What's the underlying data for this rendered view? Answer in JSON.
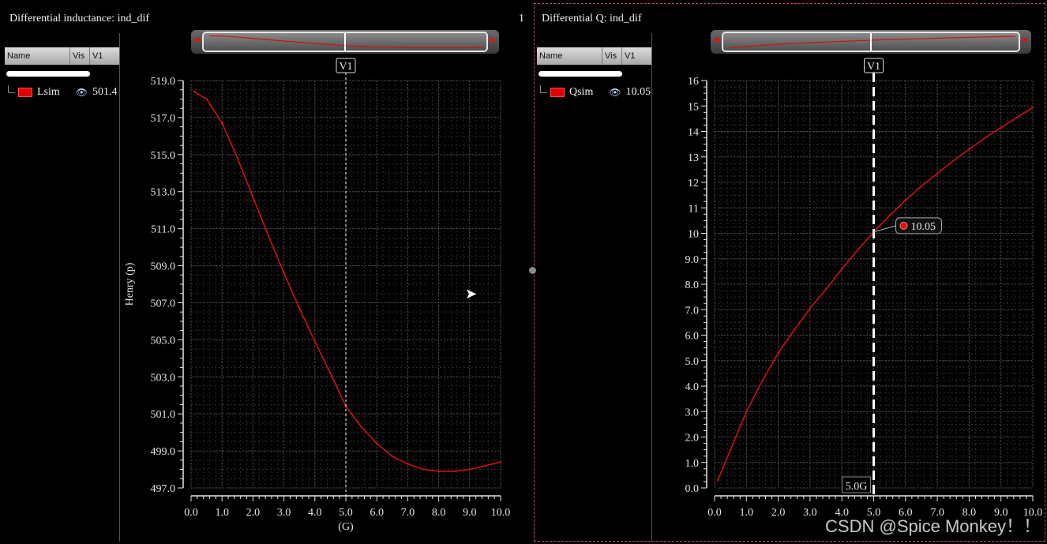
{
  "left": {
    "title": "Differential inductance: ind_dif",
    "index": "1",
    "legend": {
      "col_name": "Name",
      "col_vis": "Vis",
      "col_v1": "V1",
      "trace": "Lsim",
      "value": "501.4"
    }
  },
  "right": {
    "title": "Differential Q: ind_dif",
    "legend": {
      "col_name": "Name",
      "col_vis": "Vis",
      "col_v1": "V1",
      "trace": "Qsim",
      "value": "10.05"
    }
  },
  "watermark": "CSDN @Spice Monkey！！",
  "chart_data": [
    {
      "type": "line",
      "title": "Differential inductance: ind_dif",
      "xlabel": "(G)",
      "ylabel": "Henry (p)",
      "xlim": [
        0,
        10
      ],
      "ylim": [
        497,
        519
      ],
      "x_ticks": [
        "0.0",
        "1.0",
        "2.0",
        "3.0",
        "4.0",
        "5.0",
        "6.0",
        "7.0",
        "8.0",
        "9.0",
        "10.0"
      ],
      "y_ticks": [
        "497.0",
        "499.0",
        "501.0",
        "503.0",
        "505.0",
        "507.0",
        "509.0",
        "511.0",
        "513.0",
        "515.0",
        "517.0",
        "519.0"
      ],
      "grid": true,
      "cursor": {
        "label": "V1",
        "x": 5.0
      },
      "line_color": "#d01010",
      "series": [
        {
          "name": "Lsim",
          "x": [
            0.1,
            0.5,
            1.0,
            1.5,
            2.0,
            2.5,
            3.0,
            3.5,
            4.0,
            4.5,
            5.0,
            5.5,
            6.0,
            6.5,
            7.0,
            7.5,
            8.0,
            8.5,
            9.0,
            9.5,
            10.0
          ],
          "values": [
            518.4,
            518.0,
            516.7,
            514.8,
            512.7,
            510.6,
            508.6,
            506.7,
            504.9,
            503.2,
            501.4,
            500.3,
            499.4,
            498.7,
            498.3,
            498.0,
            497.9,
            497.9,
            498.0,
            498.2,
            498.4
          ]
        }
      ]
    },
    {
      "type": "line",
      "title": "Differential Q: ind_dif",
      "xlabel": "",
      "ylabel": "",
      "xlim": [
        0,
        10
      ],
      "ylim": [
        0,
        16
      ],
      "x_ticks": [
        "0.0",
        "1.0",
        "2.0",
        "3.0",
        "4.0",
        "5.0",
        "6.0",
        "7.0",
        "8.0",
        "9.0",
        "10.0"
      ],
      "y_ticks": [
        "0.0",
        "1.0",
        "2.0",
        "3.0",
        "4.0",
        "5.0",
        "6.0",
        "7.0",
        "8.0",
        "9.0",
        "10",
        "11",
        "12",
        "13",
        "14",
        "15",
        "16"
      ],
      "grid": true,
      "cursor": {
        "label": "V1",
        "x": 5.0,
        "x_label": "5.0G",
        "marker_value": "10.05",
        "marker_y": 10.05
      },
      "line_color": "#d01010",
      "series": [
        {
          "name": "Qsim",
          "x": [
            0.1,
            0.5,
            1.0,
            1.5,
            2.0,
            2.5,
            3.0,
            3.5,
            4.0,
            4.5,
            5.0,
            5.5,
            6.0,
            6.5,
            7.0,
            7.5,
            8.0,
            8.5,
            9.0,
            9.5,
            10.0
          ],
          "values": [
            0.3,
            1.5,
            3.0,
            4.2,
            5.3,
            6.2,
            7.05,
            7.8,
            8.6,
            9.35,
            10.05,
            10.7,
            11.3,
            11.85,
            12.35,
            12.85,
            13.3,
            13.75,
            14.15,
            14.55,
            14.95
          ]
        }
      ]
    }
  ]
}
